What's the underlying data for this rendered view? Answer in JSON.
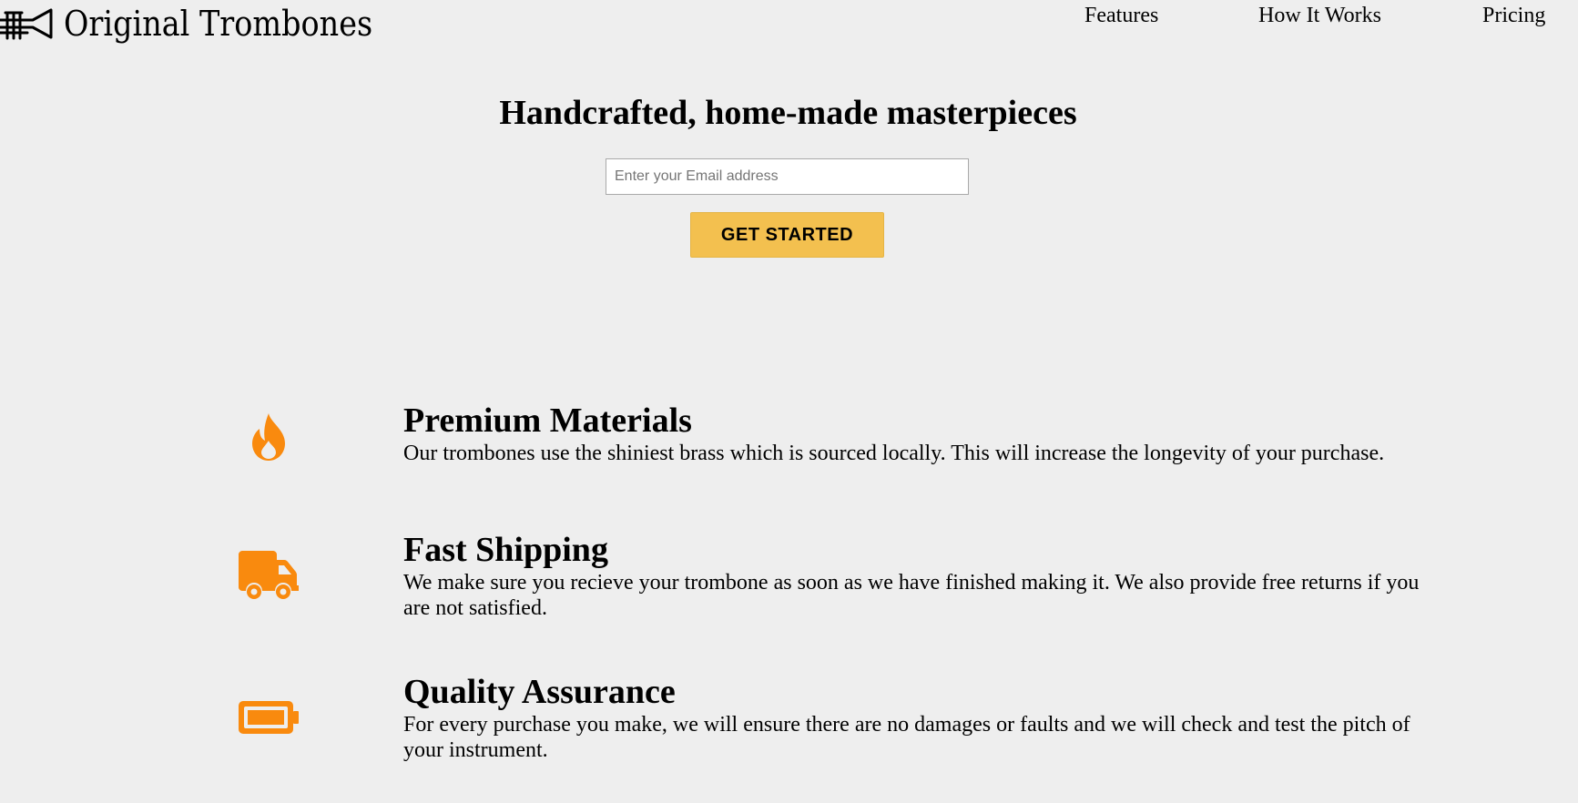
{
  "header": {
    "logo_icon": "trombone-icon",
    "brand_name": "Original Trombones",
    "nav": {
      "features": "Features",
      "how_it_works": "How It Works",
      "pricing": "Pricing"
    }
  },
  "hero": {
    "title": "Handcrafted, home-made masterpieces",
    "email_placeholder": "Enter your Email address",
    "email_value": "",
    "cta_label": "GET STARTED"
  },
  "features": [
    {
      "icon": "fire-icon",
      "title": "Premium Materials",
      "description": "Our trombones use the shiniest brass which is sourced locally. This will increase the longevity of your purchase."
    },
    {
      "icon": "truck-icon",
      "title": "Fast Shipping",
      "description": "We make sure you recieve your trombone as soon as we have finished making it. We also provide free returns if you are not satisfied."
    },
    {
      "icon": "battery-icon",
      "title": "Quality Assurance",
      "description": "For every purchase you make, we will ensure there are no damages or faults and we will check and test the pitch of your instrument."
    }
  ],
  "colors": {
    "background": "#eeeeee",
    "accent_button": "#f3c04f",
    "icon_orange": "#f98a0e"
  }
}
